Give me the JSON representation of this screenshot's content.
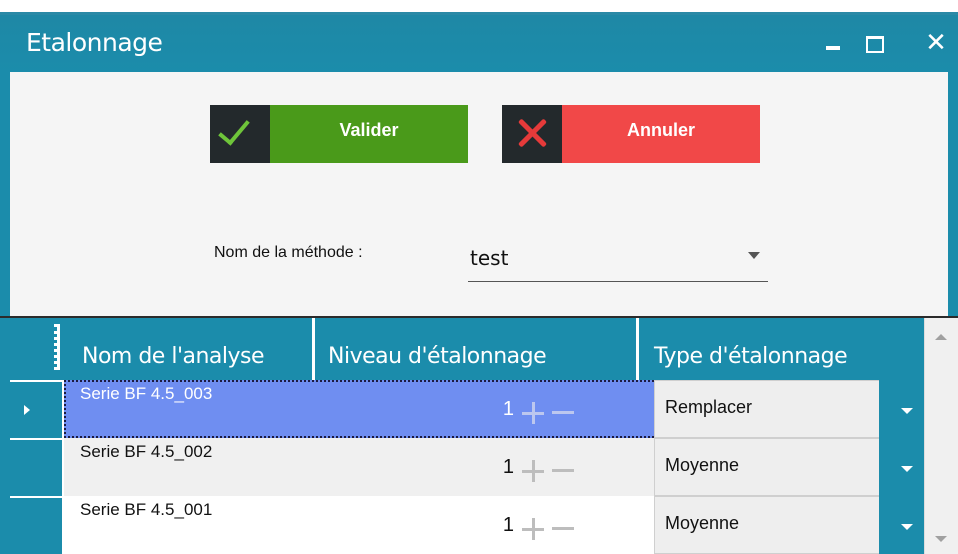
{
  "window": {
    "title": "Etalonnage",
    "controls": {
      "minimize": "minimize-icon",
      "maximize": "maximize-icon",
      "close": "close-icon",
      "close_glyph": "✕"
    }
  },
  "actions": {
    "validate_label": "Valider",
    "cancel_label": "Annuler",
    "validate_color": "#4a9a1a",
    "cancel_color": "#f14848"
  },
  "method": {
    "label": "Nom de la méthode :",
    "value": "test"
  },
  "grid": {
    "columns": [
      "Nom de l'analyse",
      "Niveau d'étalonnage",
      "Type d'étalonnage"
    ],
    "rows": [
      {
        "name": "Serie BF 4.5_003",
        "level": "1",
        "type": "Remplacer",
        "selected": true
      },
      {
        "name": "Serie BF 4.5_002",
        "level": "1",
        "type": "Moyenne",
        "selected": false
      },
      {
        "name": "Serie BF 4.5_001",
        "level": "1",
        "type": "Moyenne",
        "selected": false
      }
    ]
  },
  "colors": {
    "accent": "#1b8cab",
    "selected_row": "#6f8ef1"
  }
}
